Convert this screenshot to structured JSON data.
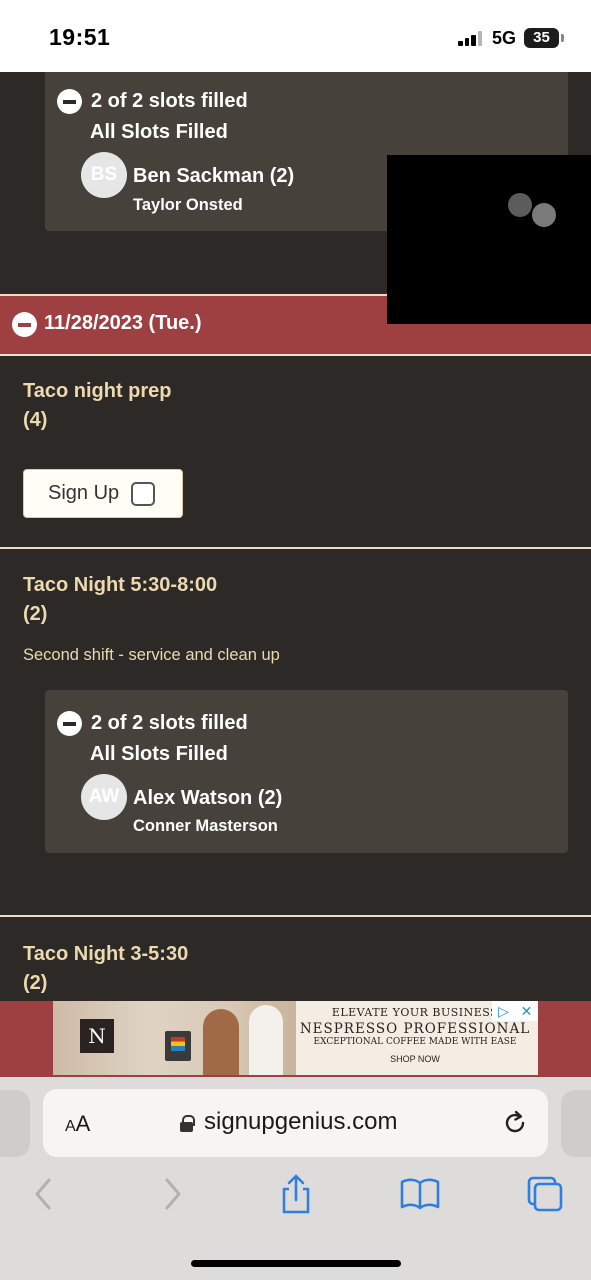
{
  "status_bar": {
    "time": "19:51",
    "network": "5G",
    "battery": "35"
  },
  "top_slot": {
    "filled": "2 of 2 slots filled",
    "status": "All Slots Filled",
    "person": {
      "initials": "BS",
      "name": "Ben Sackman (2)",
      "sub": "Taylor Onsted"
    }
  },
  "date_header": {
    "label": "11/28/2023 (Tue.)"
  },
  "items": [
    {
      "title": "Taco night prep",
      "count": "(4)",
      "signup_label": "Sign Up"
    },
    {
      "title": "Taco Night 5:30-8:00",
      "count": "(2)",
      "description": "Second shift - service and clean up",
      "slot": {
        "filled": "2 of 2 slots filled",
        "status": "All Slots Filled",
        "person": {
          "initials": "AW",
          "name": "Alex Watson (2)",
          "sub": "Conner Masterson"
        }
      }
    },
    {
      "title": "Taco Night 3-5:30",
      "count": "(2)"
    }
  ],
  "ad": {
    "logo": "N",
    "line1": "ELEVATE YOUR BUSINESS",
    "line2": "NESPRESSO PROFESSIONAL",
    "line3": "EXCEPTIONAL COFFEE MADE WITH EASE",
    "cta": "SHOP NOW",
    "choices_icon": "▷",
    "close_icon": "✕"
  },
  "browser": {
    "aa_big": "A",
    "aa_small": "A",
    "url": "signupgenius.com"
  },
  "colors": {
    "background": "#2d2926",
    "slot_box": "#47413c",
    "date_bar": "#9e4042",
    "accent_text": "#ecd9b0",
    "ios_blue": "#2f7fe0"
  }
}
